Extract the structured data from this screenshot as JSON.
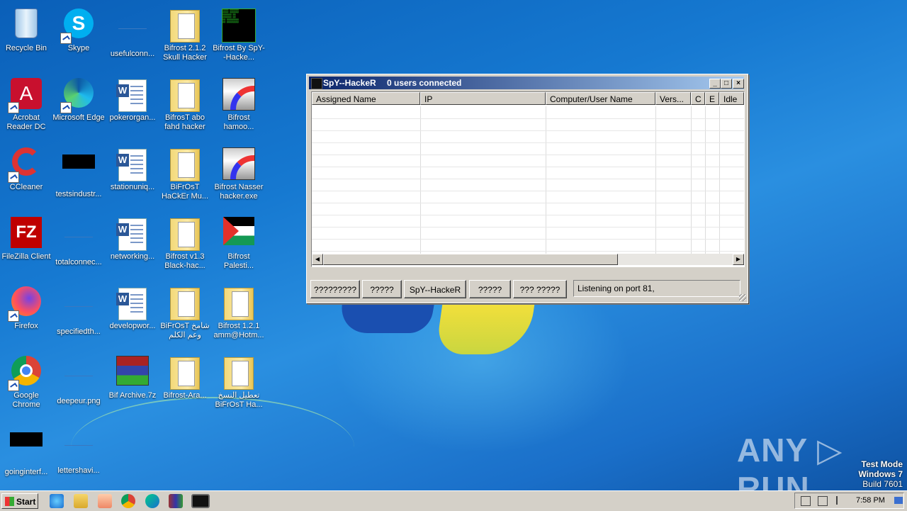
{
  "desktop": {
    "icons": [
      {
        "label": "Recycle Bin",
        "type": "bin"
      },
      {
        "label": "Acrobat Reader DC",
        "type": "acrobat"
      },
      {
        "label": "CCleaner",
        "type": "ccleaner"
      },
      {
        "label": "FileZilla Client",
        "type": "filezilla"
      },
      {
        "label": "Firefox",
        "type": "firefox"
      },
      {
        "label": "Google Chrome",
        "type": "chrome"
      },
      {
        "label": "goinginterf...",
        "type": "black"
      },
      {
        "label": "Skype",
        "type": "skype"
      },
      {
        "label": "Microsoft Edge",
        "type": "edge"
      },
      {
        "label": "testsindustr...",
        "type": "black"
      },
      {
        "label": "totalconnec...",
        "type": "blank"
      },
      {
        "label": "specifiedth...",
        "type": "blank"
      },
      {
        "label": "deepeur.png",
        "type": "blank"
      },
      {
        "label": "lettershavi...",
        "type": "blank"
      },
      {
        "label": "usefulconn...",
        "type": "blank"
      },
      {
        "label": "pokerorgan...",
        "type": "word"
      },
      {
        "label": "stationuniq...",
        "type": "word"
      },
      {
        "label": "networking...",
        "type": "word"
      },
      {
        "label": "developwor...",
        "type": "word"
      },
      {
        "label": "Bif Archive.7z",
        "type": "winrar"
      },
      {
        "label": "Bifrost 2.1.2 Skull Hacker",
        "type": "folder"
      },
      {
        "label": "BifrosT abo fahd hacker",
        "type": "folder"
      },
      {
        "label": "BiFrOsT HaCkEr Mu...",
        "type": "folder"
      },
      {
        "label": "Bifrost v1.3 Black-hac...",
        "type": "folder"
      },
      {
        "label": "BiFrOsT شامخ وعم الكلم",
        "type": "folder"
      },
      {
        "label": "Bifrost-Ara...",
        "type": "folder"
      },
      {
        "label": "Bifrost By SpY--Hacke...",
        "type": "terminal"
      },
      {
        "label": "Bifrost hamoo...",
        "type": "rainbow"
      },
      {
        "label": "Bifrost Nasser hacker.exe",
        "type": "rainbow"
      },
      {
        "label": "Bifrost Palesti...",
        "type": "palestine"
      },
      {
        "label": "Bifrost 1.2.1 amm@Hotm...",
        "type": "folder"
      },
      {
        "label": "تعطيل النسخ BiFrOsT Ha...",
        "type": "folder"
      }
    ]
  },
  "window": {
    "title": "SpY--HackeR",
    "status": "0 users connected",
    "controls": {
      "minimize": "_",
      "maximize": "□",
      "close": "×"
    },
    "columns": [
      "Assigned Name",
      "IP",
      "Computer/User Name",
      "Vers...",
      "C",
      "E",
      "Idle"
    ],
    "buttons": [
      "?????????",
      "?????",
      "SpY--HackeR",
      "?????",
      "??? ?????"
    ],
    "statusbar": "Listening on port 81,"
  },
  "taskbar": {
    "start_label": "Start",
    "clock": "7:58 PM"
  },
  "watermark": {
    "text": "ANY ▷ RUN",
    "test_mode": [
      "Test Mode",
      "Windows 7",
      "Build 7601"
    ]
  }
}
